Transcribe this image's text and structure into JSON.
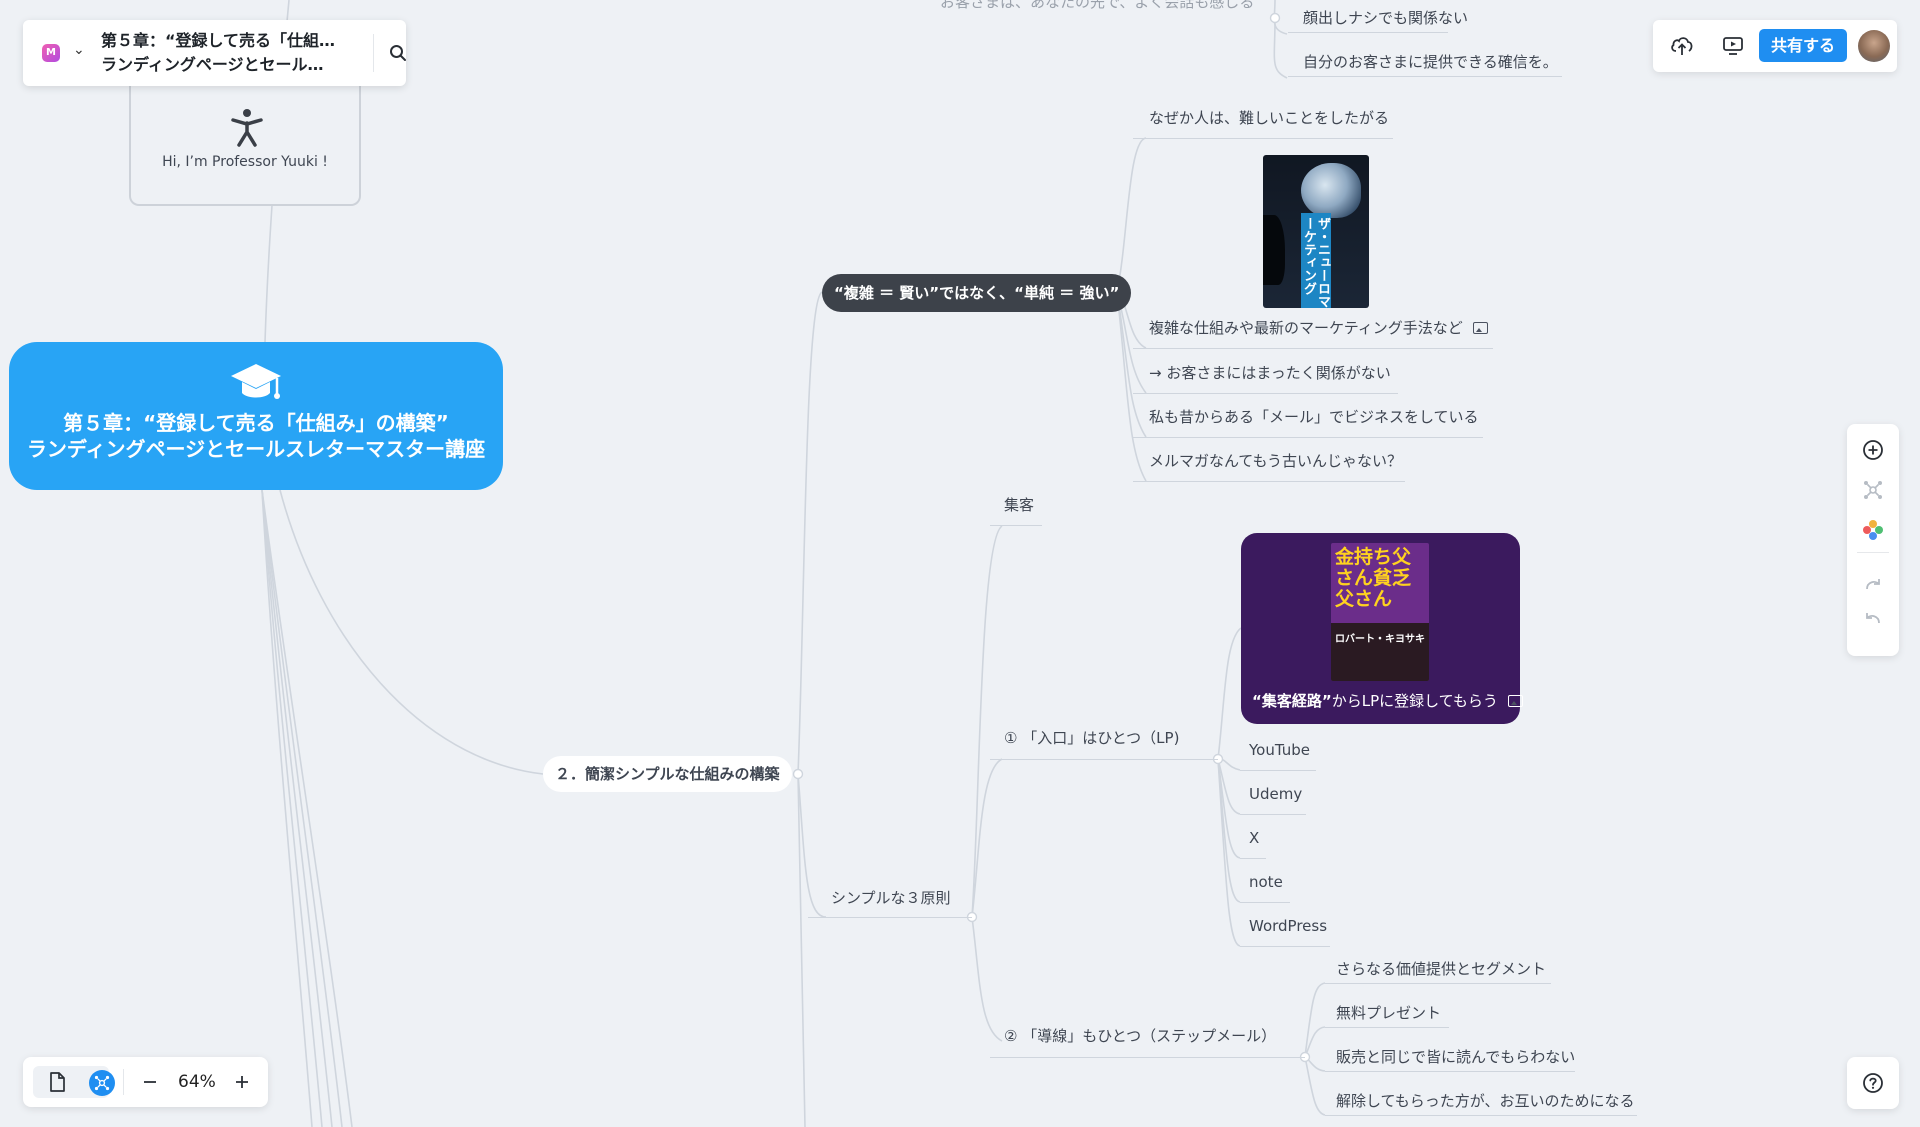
{
  "app": {
    "doc_title_line1": "第５章：“登録して売る「仕組…",
    "doc_title_line2": "ランディングページとセール…",
    "share_label": "共有する",
    "zoom": "64%"
  },
  "icons": {
    "logo": "mindmeister-logo-icon",
    "search": "search-icon",
    "cloud": "cloud-upload-icon",
    "present": "presentation-icon",
    "add": "plus-circle-icon",
    "layout": "mindmap-layout-icon",
    "color": "color-palette-icon",
    "redo": "redo-icon",
    "undo": "undo-icon",
    "help": "help-icon",
    "doc": "document-view-icon",
    "map": "mindmap-view-icon"
  },
  "colors": {
    "accent": "#1f8ef1",
    "root": "#28a4f5",
    "dark_pill": "#3d424a",
    "purple_card": "#3b1a5e"
  },
  "map": {
    "root": {
      "line1": "第５章：“登録して売る「仕組み」の構築”",
      "line2": "ランディングページとセールスレターマスター講座"
    },
    "professor": "Hi, I’m  Professor  Yuuki !",
    "top_nodes": [
      "お客さまは、あなたの先で、よく会話も感じる",
      "顔出しナシでも関係ない",
      "自分のお客さまに提供できる確信を。"
    ],
    "complex_simple": "“複雑 ＝ 賢い”ではなく、“単純 ＝ 強い”",
    "complex_children": [
      "なぜか人は、難しいことをしたがる",
      "複雑な仕組みや最新のマーケティング手法など",
      "→ お客さまにはまったく関係がない",
      "私も昔からある「メール」でビジネスをしている",
      "メルマガなんてもう古いんじゃない？"
    ],
    "book1_title": "ザ・ニューロマーケティング",
    "section2": "２．簡潔シンプルな仕組みの構築",
    "shuukyaku": "集客",
    "simple3": "シンプルな３原則",
    "rule1": "①  「入口」はひとつ（LP)",
    "purple_caption_bold": "“集客経路”",
    "purple_caption_rest": "からLPに登録してもらう",
    "book2_title": "金持ち父さん貧乏父さん",
    "book2_author": "ロバート・キヨサキ",
    "channels": [
      "YouTube",
      "Udemy",
      "X",
      "note",
      "WordPress"
    ],
    "rule2": "②  「導線」もひとつ（ステップメール）",
    "rule2_children": [
      "さらなる価値提供とセグメント",
      "無料プレゼント",
      "販売と同じで皆に読んでもらわない",
      "解除してもらった方が、お互いのためになる"
    ]
  }
}
